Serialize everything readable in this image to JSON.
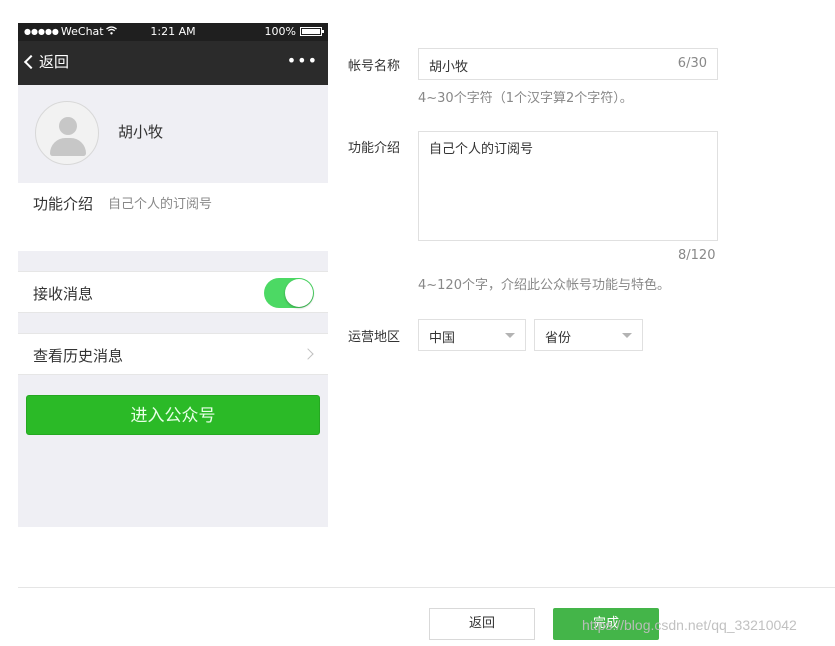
{
  "phone": {
    "status": {
      "carrier": "WeChat",
      "time": "1:21 AM",
      "battery": "100%"
    },
    "nav": {
      "back_label": "返回",
      "more_label": "•••"
    },
    "profile": {
      "name": "胡小牧"
    },
    "description": {
      "label": "功能介绍",
      "value": "自己个人的订阅号"
    },
    "receive_messages": {
      "label": "接收消息",
      "enabled": true
    },
    "history": {
      "label": "查看历史消息"
    },
    "enter_button": "进入公众号"
  },
  "form": {
    "account_name": {
      "label": "帐号名称",
      "value": "胡小牧",
      "counter": "6/30",
      "hint": "4~30个字符（1个汉字算2个字符）。"
    },
    "intro": {
      "label": "功能介绍",
      "value": "自己个人的订阅号",
      "counter": "8/120",
      "hint": "4~120个字，介绍此公众帐号功能与特色。"
    },
    "region": {
      "label": "运营地区",
      "country": "中国",
      "province": "省份"
    }
  },
  "footer": {
    "back_button": "返回",
    "done_button": "完成"
  },
  "watermark": "https://blog.csdn.net/qq_33210042",
  "colors": {
    "toggle_on": "#4cd964",
    "primary_green": "#44b549",
    "enter_green": "#2bba27"
  }
}
